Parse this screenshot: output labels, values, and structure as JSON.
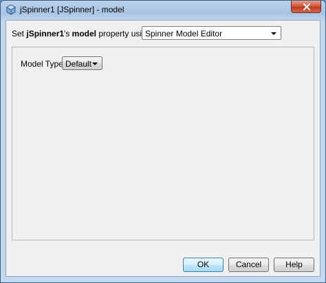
{
  "window": {
    "title": "jSpinner1 [JSpinner] - model"
  },
  "property": {
    "prefix": "Set ",
    "component": "jSpinner1",
    "middle": "'s ",
    "property_name": "model",
    "suffix": " property using:",
    "editor_selected": "Spinner Model Editor"
  },
  "panel": {
    "model_type_label": "Model Type:",
    "model_type_selected": "Default"
  },
  "buttons": {
    "ok": "OK",
    "cancel": "Cancel",
    "help": "Help"
  },
  "icons": {
    "app": "netbeans-cube-icon",
    "close": "close-icon",
    "dropdown": "chevron-down-icon"
  },
  "colors": {
    "close_button": "#c7432a",
    "default_button_border": "#3c7fb1"
  }
}
